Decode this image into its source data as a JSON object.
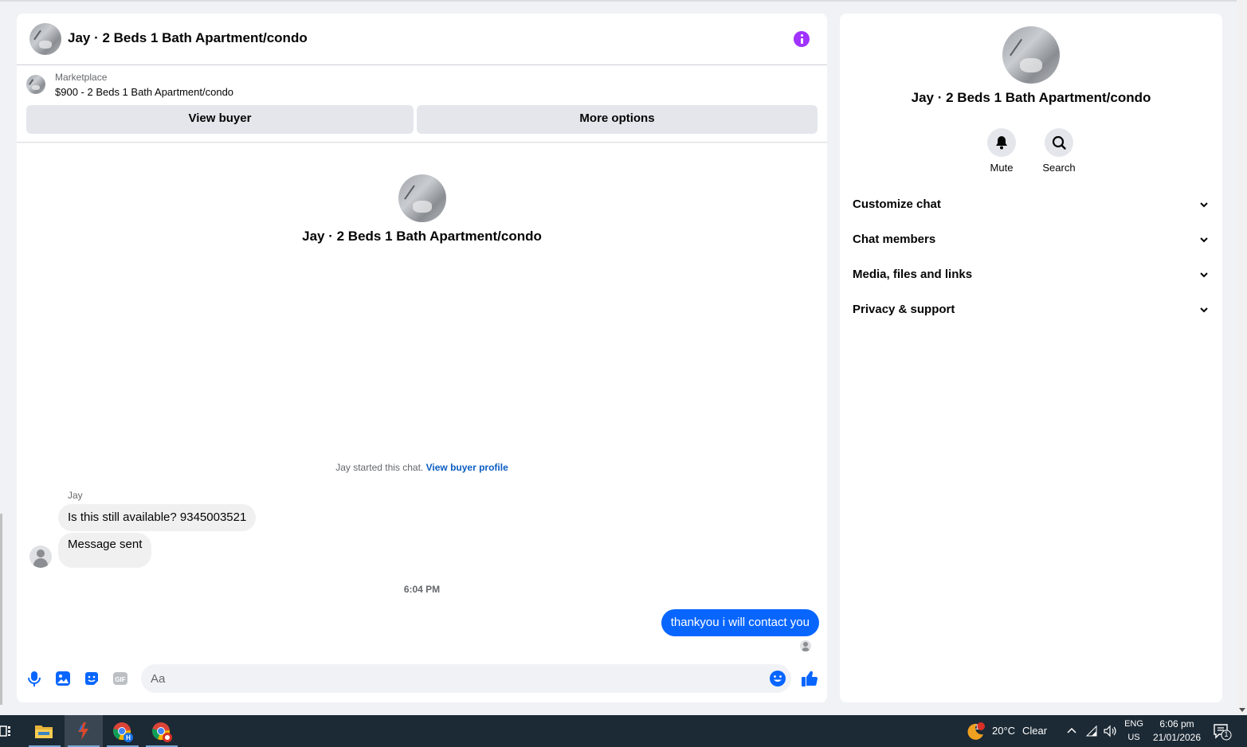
{
  "chat": {
    "header_title": "Jay · 2 Beds 1 Bath Apartment/condo",
    "listing_source": "Marketplace",
    "listing_title": "$900 - 2 Beds 1 Bath Apartment/condo",
    "view_buyer_label": "View buyer",
    "more_options_label": "More options",
    "center_title": "Jay · 2 Beds 1 Bath Apartment/condo",
    "started_text": "Jay started this chat.",
    "view_profile_link": "View buyer profile",
    "messages_in_sender": "Jay",
    "message_1": "Is this still available? 9345003521",
    "message_2": "Message sent",
    "timestamp": "6:04 PM",
    "message_out": "thankyou i will contact you",
    "composer_placeholder": "Aa"
  },
  "details": {
    "title": "Jay · 2 Beds 1 Bath Apartment/condo",
    "actions": [
      {
        "label": "Mute",
        "icon": "bell-icon"
      },
      {
        "label": "Search",
        "icon": "search-icon"
      }
    ],
    "sections": [
      {
        "label": "Customize chat"
      },
      {
        "label": "Chat members"
      },
      {
        "label": "Media, files and links"
      },
      {
        "label": "Privacy & support"
      }
    ]
  },
  "taskbar": {
    "weather_temp": "20°C",
    "weather_text": "Clear",
    "weather_badge": "1",
    "lang_1": "ENG",
    "lang_2": "US",
    "time": "6:06 pm",
    "date": "21/01/2026",
    "notif_count": "1"
  },
  "colors": {
    "accent": "#0866ff",
    "info": "#a033ff",
    "link": "#0a5dc2"
  }
}
